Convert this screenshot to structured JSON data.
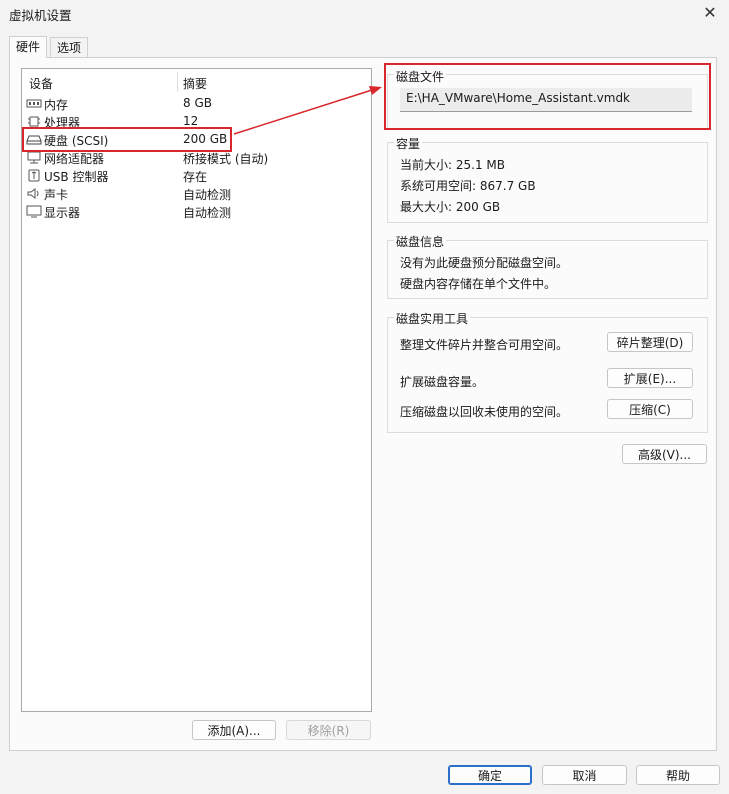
{
  "window": {
    "title": "虚拟机设置",
    "close_icon": "close-icon"
  },
  "tabs": [
    {
      "label": "硬件"
    },
    {
      "label": "选项"
    }
  ],
  "device_list": {
    "headers": {
      "device": "设备",
      "summary": "摘要"
    },
    "rows": [
      {
        "icon": "memory-icon",
        "name": "内存",
        "summary": "8 GB"
      },
      {
        "icon": "processor-icon",
        "name": "处理器",
        "summary": "12"
      },
      {
        "icon": "hard-disk-icon",
        "name": "硬盘 (SCSI)",
        "summary": "200 GB"
      },
      {
        "icon": "network-adapter-icon",
        "name": "网络适配器",
        "summary": "桥接模式 (自动)"
      },
      {
        "icon": "usb-icon",
        "name": "USB 控制器",
        "summary": "存在"
      },
      {
        "icon": "sound-card-icon",
        "name": "声卡",
        "summary": "自动检测"
      },
      {
        "icon": "display-icon",
        "name": "显示器",
        "summary": "自动检测"
      }
    ],
    "add_button": "添加(A)...",
    "remove_button": "移除(R)"
  },
  "disk_file": {
    "title": "磁盘文件",
    "path": "E:\\HA_VMware\\Home_Assistant.vmdk"
  },
  "capacity": {
    "title": "容量",
    "current_size": "当前大小: 25.1 MB",
    "system_free": "系统可用空间: 867.7 GB",
    "max_size": "最大大小: 200 GB"
  },
  "disk_info": {
    "title": "磁盘信息",
    "line1": "没有为此硬盘预分配磁盘空间。",
    "line2": "硬盘内容存储在单个文件中。"
  },
  "disk_utilities": {
    "title": "磁盘实用工具",
    "defrag_text": "整理文件碎片并整合可用空间。",
    "defrag_button": "碎片整理(D)",
    "expand_text": "扩展磁盘容量。",
    "expand_button": "扩展(E)...",
    "compact_text": "压缩磁盘以回收未使用的空间。",
    "compact_button": "压缩(C)"
  },
  "advanced_button": "高级(V)...",
  "footer": {
    "ok": "确定",
    "cancel": "取消",
    "help": "帮助"
  },
  "annotation_color": "#d9282d"
}
